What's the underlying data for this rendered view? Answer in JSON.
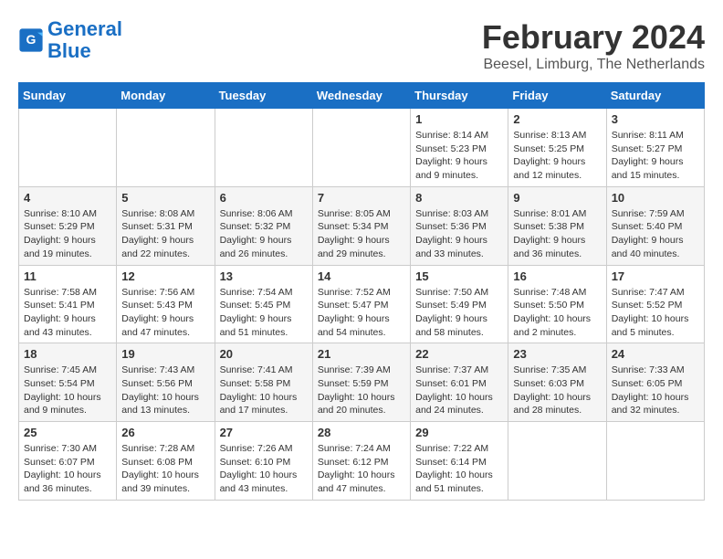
{
  "logo": {
    "line1": "General",
    "line2": "Blue"
  },
  "title": "February 2024",
  "subtitle": "Beesel, Limburg, The Netherlands",
  "days_of_week": [
    "Sunday",
    "Monday",
    "Tuesday",
    "Wednesday",
    "Thursday",
    "Friday",
    "Saturday"
  ],
  "weeks": [
    [
      {
        "day": "",
        "info": ""
      },
      {
        "day": "",
        "info": ""
      },
      {
        "day": "",
        "info": ""
      },
      {
        "day": "",
        "info": ""
      },
      {
        "day": "1",
        "info": "Sunrise: 8:14 AM\nSunset: 5:23 PM\nDaylight: 9 hours\nand 9 minutes."
      },
      {
        "day": "2",
        "info": "Sunrise: 8:13 AM\nSunset: 5:25 PM\nDaylight: 9 hours\nand 12 minutes."
      },
      {
        "day": "3",
        "info": "Sunrise: 8:11 AM\nSunset: 5:27 PM\nDaylight: 9 hours\nand 15 minutes."
      }
    ],
    [
      {
        "day": "4",
        "info": "Sunrise: 8:10 AM\nSunset: 5:29 PM\nDaylight: 9 hours\nand 19 minutes."
      },
      {
        "day": "5",
        "info": "Sunrise: 8:08 AM\nSunset: 5:31 PM\nDaylight: 9 hours\nand 22 minutes."
      },
      {
        "day": "6",
        "info": "Sunrise: 8:06 AM\nSunset: 5:32 PM\nDaylight: 9 hours\nand 26 minutes."
      },
      {
        "day": "7",
        "info": "Sunrise: 8:05 AM\nSunset: 5:34 PM\nDaylight: 9 hours\nand 29 minutes."
      },
      {
        "day": "8",
        "info": "Sunrise: 8:03 AM\nSunset: 5:36 PM\nDaylight: 9 hours\nand 33 minutes."
      },
      {
        "day": "9",
        "info": "Sunrise: 8:01 AM\nSunset: 5:38 PM\nDaylight: 9 hours\nand 36 minutes."
      },
      {
        "day": "10",
        "info": "Sunrise: 7:59 AM\nSunset: 5:40 PM\nDaylight: 9 hours\nand 40 minutes."
      }
    ],
    [
      {
        "day": "11",
        "info": "Sunrise: 7:58 AM\nSunset: 5:41 PM\nDaylight: 9 hours\nand 43 minutes."
      },
      {
        "day": "12",
        "info": "Sunrise: 7:56 AM\nSunset: 5:43 PM\nDaylight: 9 hours\nand 47 minutes."
      },
      {
        "day": "13",
        "info": "Sunrise: 7:54 AM\nSunset: 5:45 PM\nDaylight: 9 hours\nand 51 minutes."
      },
      {
        "day": "14",
        "info": "Sunrise: 7:52 AM\nSunset: 5:47 PM\nDaylight: 9 hours\nand 54 minutes."
      },
      {
        "day": "15",
        "info": "Sunrise: 7:50 AM\nSunset: 5:49 PM\nDaylight: 9 hours\nand 58 minutes."
      },
      {
        "day": "16",
        "info": "Sunrise: 7:48 AM\nSunset: 5:50 PM\nDaylight: 10 hours\nand 2 minutes."
      },
      {
        "day": "17",
        "info": "Sunrise: 7:47 AM\nSunset: 5:52 PM\nDaylight: 10 hours\nand 5 minutes."
      }
    ],
    [
      {
        "day": "18",
        "info": "Sunrise: 7:45 AM\nSunset: 5:54 PM\nDaylight: 10 hours\nand 9 minutes."
      },
      {
        "day": "19",
        "info": "Sunrise: 7:43 AM\nSunset: 5:56 PM\nDaylight: 10 hours\nand 13 minutes."
      },
      {
        "day": "20",
        "info": "Sunrise: 7:41 AM\nSunset: 5:58 PM\nDaylight: 10 hours\nand 17 minutes."
      },
      {
        "day": "21",
        "info": "Sunrise: 7:39 AM\nSunset: 5:59 PM\nDaylight: 10 hours\nand 20 minutes."
      },
      {
        "day": "22",
        "info": "Sunrise: 7:37 AM\nSunset: 6:01 PM\nDaylight: 10 hours\nand 24 minutes."
      },
      {
        "day": "23",
        "info": "Sunrise: 7:35 AM\nSunset: 6:03 PM\nDaylight: 10 hours\nand 28 minutes."
      },
      {
        "day": "24",
        "info": "Sunrise: 7:33 AM\nSunset: 6:05 PM\nDaylight: 10 hours\nand 32 minutes."
      }
    ],
    [
      {
        "day": "25",
        "info": "Sunrise: 7:30 AM\nSunset: 6:07 PM\nDaylight: 10 hours\nand 36 minutes."
      },
      {
        "day": "26",
        "info": "Sunrise: 7:28 AM\nSunset: 6:08 PM\nDaylight: 10 hours\nand 39 minutes."
      },
      {
        "day": "27",
        "info": "Sunrise: 7:26 AM\nSunset: 6:10 PM\nDaylight: 10 hours\nand 43 minutes."
      },
      {
        "day": "28",
        "info": "Sunrise: 7:24 AM\nSunset: 6:12 PM\nDaylight: 10 hours\nand 47 minutes."
      },
      {
        "day": "29",
        "info": "Sunrise: 7:22 AM\nSunset: 6:14 PM\nDaylight: 10 hours\nand 51 minutes."
      },
      {
        "day": "",
        "info": ""
      },
      {
        "day": "",
        "info": ""
      }
    ]
  ]
}
